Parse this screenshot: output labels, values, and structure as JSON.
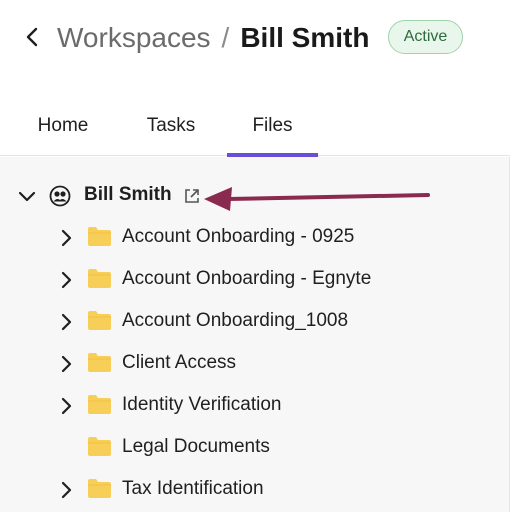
{
  "header": {
    "breadcrumb_parent": "Workspaces",
    "breadcrumb_separator": "/",
    "title": "Bill Smith",
    "status": "Active"
  },
  "tabs": [
    {
      "label": "Home",
      "active": false
    },
    {
      "label": "Tasks",
      "active": false
    },
    {
      "label": "Files",
      "active": true
    }
  ],
  "tree": {
    "root": {
      "label": "Bill Smith",
      "icon": "user-group-icon",
      "expanded": true
    },
    "folders": [
      {
        "label": "Account Onboarding - 0925",
        "expandable": true
      },
      {
        "label": "Account Onboarding - Egnyte",
        "expandable": true
      },
      {
        "label": "Account Onboarding_1008",
        "expandable": true
      },
      {
        "label": "Client Access",
        "expandable": true
      },
      {
        "label": "Identity Verification",
        "expandable": true
      },
      {
        "label": "Legal Documents",
        "expandable": false
      },
      {
        "label": "Tax Identification",
        "expandable": true
      }
    ]
  },
  "colors": {
    "accent": "#6a4fd6",
    "badge_bg": "#e9f6ec",
    "badge_border": "#9fd3ab",
    "badge_text": "#2d6a3e",
    "folder": "#f7cf58",
    "annotation_arrow": "#8a2a4e"
  }
}
